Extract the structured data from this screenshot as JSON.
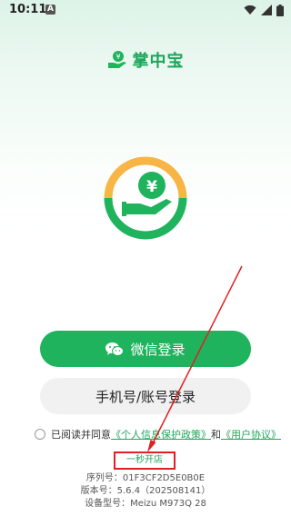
{
  "status_bar": {
    "time": "10:11",
    "notification_badge": "A",
    "icons": [
      "wifi-icon",
      "signal-icon",
      "battery-icon"
    ]
  },
  "brand": {
    "name": "掌中宝",
    "accent_color": "#1fb35d",
    "logo_icon": "coin-in-hand-icon"
  },
  "login": {
    "wechat_label": "微信登录",
    "phone_label": "手机号/账号登录"
  },
  "agreement": {
    "prefix": "已阅读并同意",
    "privacy_link": "《个人信息保护政策》",
    "conjunction": "和",
    "user_link": "《用户协议》"
  },
  "quick_open": {
    "label": "一秒开店",
    "highlight_color": "#e02020"
  },
  "device_info": {
    "serial": "序列号：01F3CF2D5E0B0E",
    "version": "版本号：5.6.4（202508141）",
    "model": "设备型号：Meizu M973Q 28"
  }
}
